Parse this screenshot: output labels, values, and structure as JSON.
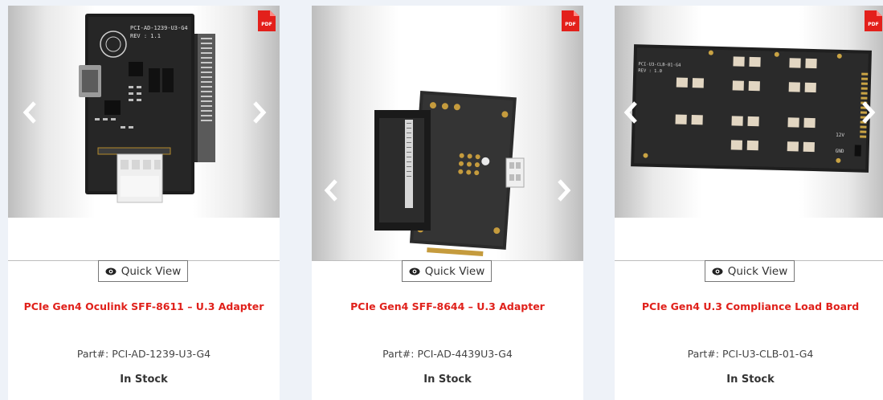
{
  "colors": {
    "title_red": "#e0211b",
    "pdf_red": "#e3201b",
    "page_bg": "#eef2f8"
  },
  "icons": {
    "pdf": "pdf-document-icon",
    "prev": "chevron-left-icon",
    "next": "chevron-right-icon",
    "quick_view": "eye-icon"
  },
  "products": [
    {
      "pdf_label": "PDF",
      "quick_view": "Quick View",
      "name": "PCIe Gen4 Oculink SFF-8611 – U.3 Adapter",
      "part_label": "Part#:",
      "part_number": "PCI-AD-1239-U3-G4",
      "stock": "In Stock",
      "board_print": "PCI-AD-1239-U3-G4",
      "board_rev": "REV : 1.1"
    },
    {
      "pdf_label": "PDF",
      "quick_view": "Quick View",
      "name": "PCIe Gen4 SFF-8644 – U.3 Adapter",
      "part_label": "Part#:",
      "part_number": "PCI-AD-4439U3-G4",
      "stock": "In Stock"
    },
    {
      "pdf_label": "PDF",
      "quick_view": "Quick View",
      "name": "PCIe Gen4 U.3 Compliance Load Board",
      "part_label": "Part#:",
      "part_number": "PCI-U3-CLB-01-G4",
      "stock": "In Stock",
      "board_print": "PCI-U3-CLB-01-G4",
      "board_rev": "REV : 1.0",
      "board_12v": "12V",
      "board_gnd": "GND"
    }
  ]
}
